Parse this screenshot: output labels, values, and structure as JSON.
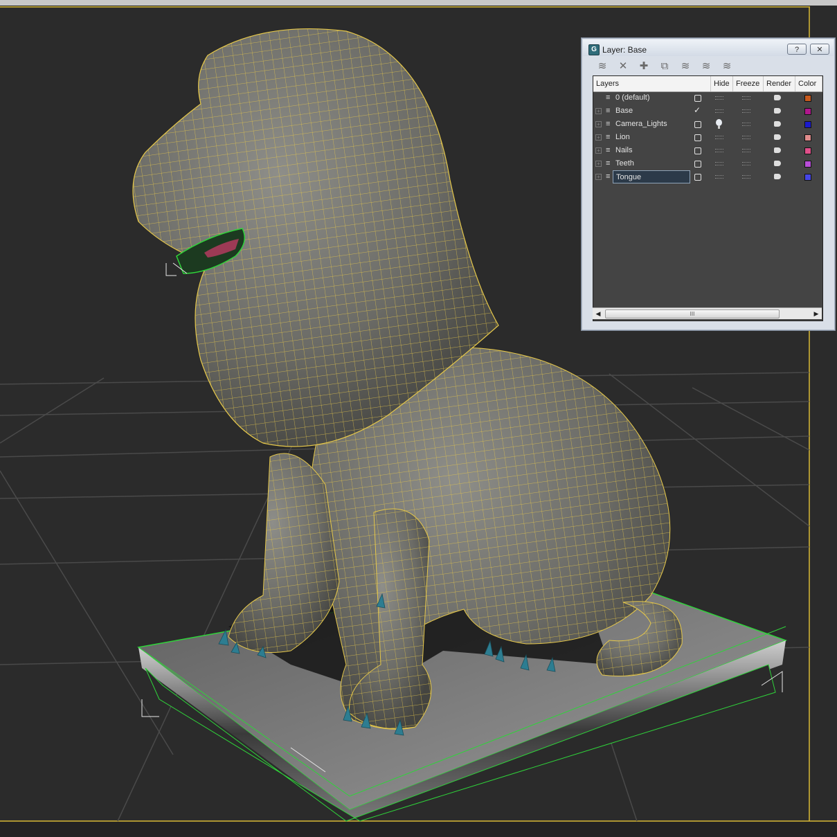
{
  "dialog": {
    "title": "Layer: Base",
    "help_label": "?",
    "close_label": "✕"
  },
  "toolbar": {
    "icons": [
      "create-layer-icon",
      "delete-layer-icon",
      "add-selection-icon",
      "select-objects-icon",
      "highlight-layer-icon",
      "hide-all-icon",
      "freeze-all-icon"
    ]
  },
  "layers_panel": {
    "columns": {
      "layers": "Layers",
      "hide": "Hide",
      "freeze": "Freeze",
      "render": "Render",
      "color": "Color"
    },
    "rows": [
      {
        "name": "0 (default)",
        "expandable": false,
        "active": false,
        "color": "#c85a1e"
      },
      {
        "name": "Base",
        "expandable": true,
        "active": true,
        "color": "#b0178c"
      },
      {
        "name": "Camera_Lights",
        "expandable": true,
        "active": false,
        "color": "#1a1acc",
        "light": true
      },
      {
        "name": "Lion",
        "expandable": true,
        "active": false,
        "color": "#e08c8c"
      },
      {
        "name": "Nails",
        "expandable": true,
        "active": false,
        "color": "#e0508a"
      },
      {
        "name": "Teeth",
        "expandable": true,
        "active": false,
        "color": "#b84ed8"
      },
      {
        "name": "Tongue",
        "expandable": true,
        "active": false,
        "color": "#4646e6",
        "selected": true
      }
    ]
  },
  "scrollbar": {
    "thumb_label": "III"
  },
  "colors": {
    "viewport_bg": "#2b2b2b",
    "grid": "#4a4a4a",
    "wireframe": "#e6c84a",
    "selection": "#2fd43a"
  }
}
